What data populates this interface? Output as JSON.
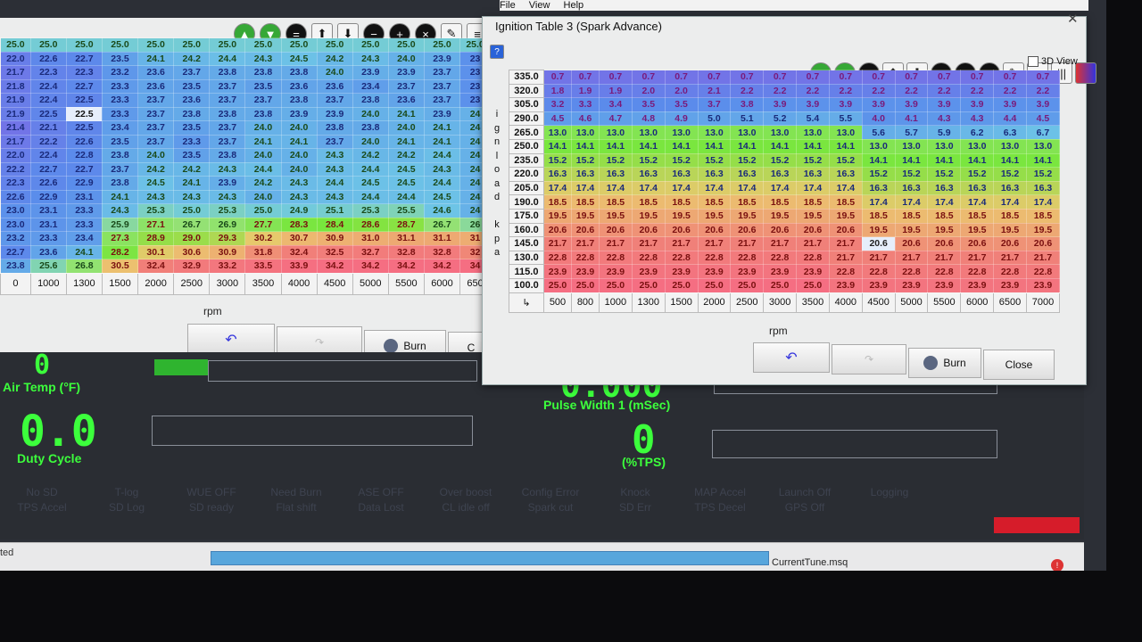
{
  "menubar": [
    "File",
    "View",
    "Help"
  ],
  "right_window": {
    "title": "Ignition Table 3 (Spark Advance)",
    "view3d_label": "3D View",
    "y_axis_label": [
      "i",
      "g",
      "n",
      "l",
      "o",
      "a",
      "d",
      "",
      "k",
      "p",
      "a"
    ],
    "x_axis_label": "rpm",
    "load_bins": [
      "335.0",
      "320.0",
      "305.0",
      "290.0",
      "265.0",
      "250.0",
      "235.0",
      "220.0",
      "205.0",
      "190.0",
      "175.0",
      "160.0",
      "145.0",
      "130.0",
      "115.0",
      "100.0"
    ],
    "rpm_bins": [
      "500",
      "800",
      "1000",
      "1300",
      "1500",
      "2000",
      "2500",
      "3000",
      "3500",
      "4000",
      "4500",
      "5000",
      "5500",
      "6000",
      "6500",
      "7000"
    ],
    "rows": [
      [
        "0.7",
        "0.7",
        "0.7",
        "0.7",
        "0.7",
        "0.7",
        "0.7",
        "0.7",
        "0.7",
        "0.7",
        "0.7",
        "0.7",
        "0.7",
        "0.7",
        "0.7",
        "0.7"
      ],
      [
        "1.8",
        "1.9",
        "1.9",
        "2.0",
        "2.0",
        "2.1",
        "2.2",
        "2.2",
        "2.2",
        "2.2",
        "2.2",
        "2.2",
        "2.2",
        "2.2",
        "2.2",
        "2.2"
      ],
      [
        "3.2",
        "3.3",
        "3.4",
        "3.5",
        "3.5",
        "3.7",
        "3.8",
        "3.9",
        "3.9",
        "3.9",
        "3.9",
        "3.9",
        "3.9",
        "3.9",
        "3.9",
        "3.9"
      ],
      [
        "4.5",
        "4.6",
        "4.7",
        "4.8",
        "4.9",
        "5.0",
        "5.1",
        "5.2",
        "5.4",
        "5.5",
        "4.0",
        "4.1",
        "4.3",
        "4.3",
        "4.4",
        "4.5"
      ],
      [
        "13.0",
        "13.0",
        "13.0",
        "13.0",
        "13.0",
        "13.0",
        "13.0",
        "13.0",
        "13.0",
        "13.0",
        "5.6",
        "5.7",
        "5.9",
        "6.2",
        "6.3",
        "6.7"
      ],
      [
        "14.1",
        "14.1",
        "14.1",
        "14.1",
        "14.1",
        "14.1",
        "14.1",
        "14.1",
        "14.1",
        "14.1",
        "13.0",
        "13.0",
        "13.0",
        "13.0",
        "13.0",
        "13.0"
      ],
      [
        "15.2",
        "15.2",
        "15.2",
        "15.2",
        "15.2",
        "15.2",
        "15.2",
        "15.2",
        "15.2",
        "15.2",
        "14.1",
        "14.1",
        "14.1",
        "14.1",
        "14.1",
        "14.1"
      ],
      [
        "16.3",
        "16.3",
        "16.3",
        "16.3",
        "16.3",
        "16.3",
        "16.3",
        "16.3",
        "16.3",
        "16.3",
        "15.2",
        "15.2",
        "15.2",
        "15.2",
        "15.2",
        "15.2"
      ],
      [
        "17.4",
        "17.4",
        "17.4",
        "17.4",
        "17.4",
        "17.4",
        "17.4",
        "17.4",
        "17.4",
        "17.4",
        "16.3",
        "16.3",
        "16.3",
        "16.3",
        "16.3",
        "16.3"
      ],
      [
        "18.5",
        "18.5",
        "18.5",
        "18.5",
        "18.5",
        "18.5",
        "18.5",
        "18.5",
        "18.5",
        "18.5",
        "17.4",
        "17.4",
        "17.4",
        "17.4",
        "17.4",
        "17.4"
      ],
      [
        "19.5",
        "19.5",
        "19.5",
        "19.5",
        "19.5",
        "19.5",
        "19.5",
        "19.5",
        "19.5",
        "19.5",
        "18.5",
        "18.5",
        "18.5",
        "18.5",
        "18.5",
        "18.5"
      ],
      [
        "20.6",
        "20.6",
        "20.6",
        "20.6",
        "20.6",
        "20.6",
        "20.6",
        "20.6",
        "20.6",
        "20.6",
        "19.5",
        "19.5",
        "19.5",
        "19.5",
        "19.5",
        "19.5"
      ],
      [
        "21.7",
        "21.7",
        "21.7",
        "21.7",
        "21.7",
        "21.7",
        "21.7",
        "21.7",
        "21.7",
        "21.7",
        "20.6",
        "20.6",
        "20.6",
        "20.6",
        "20.6",
        "20.6"
      ],
      [
        "22.8",
        "22.8",
        "22.8",
        "22.8",
        "22.8",
        "22.8",
        "22.8",
        "22.8",
        "22.8",
        "21.7",
        "21.7",
        "21.7",
        "21.7",
        "21.7",
        "21.7",
        "21.7"
      ],
      [
        "23.9",
        "23.9",
        "23.9",
        "23.9",
        "23.9",
        "23.9",
        "23.9",
        "23.9",
        "23.9",
        "22.8",
        "22.8",
        "22.8",
        "22.8",
        "22.8",
        "22.8",
        "22.8"
      ],
      [
        "25.0",
        "25.0",
        "25.0",
        "25.0",
        "25.0",
        "25.0",
        "25.0",
        "25.0",
        "25.0",
        "23.9",
        "23.9",
        "23.9",
        "23.9",
        "23.9",
        "23.9",
        "23.9"
      ]
    ],
    "buttons": {
      "undo": "",
      "redo": "",
      "burn": "Burn",
      "close": "Close"
    }
  },
  "left_window": {
    "x_axis_label": "rpm",
    "rpm_bins": [
      "0",
      "1000",
      "1300",
      "1500",
      "2000",
      "2500",
      "3000",
      "3500",
      "4000",
      "4500",
      "5000",
      "5500",
      "6000",
      "650"
    ],
    "rows": [
      [
        "25.0",
        "25.0",
        "25.0",
        "25.0",
        "25.0",
        "25.0",
        "25.0",
        "25.0",
        "25.0",
        "25.0",
        "25.0",
        "25.0",
        "25.0",
        "25.0"
      ],
      [
        "22.0",
        "22.6",
        "22.7",
        "23.5",
        "24.1",
        "24.2",
        "24.4",
        "24.3",
        "24.5",
        "24.2",
        "24.3",
        "24.0",
        "23.9",
        "23"
      ],
      [
        "21.7",
        "22.3",
        "22.3",
        "23.2",
        "23.6",
        "23.7",
        "23.8",
        "23.8",
        "23.8",
        "24.0",
        "23.9",
        "23.9",
        "23.7",
        "23"
      ],
      [
        "21.8",
        "22.4",
        "22.7",
        "23.3",
        "23.6",
        "23.5",
        "23.7",
        "23.5",
        "23.6",
        "23.6",
        "23.4",
        "23.7",
        "23.7",
        "23"
      ],
      [
        "21.9",
        "22.4",
        "22.5",
        "23.3",
        "23.7",
        "23.6",
        "23.7",
        "23.7",
        "23.8",
        "23.7",
        "23.8",
        "23.6",
        "23.7",
        "23"
      ],
      [
        "21.9",
        "22.5",
        "22.5",
        "23.3",
        "23.7",
        "23.8",
        "23.8",
        "23.8",
        "23.9",
        "23.9",
        "24.0",
        "24.1",
        "23.9",
        "24"
      ],
      [
        "21.4",
        "22.1",
        "22.5",
        "23.4",
        "23.7",
        "23.5",
        "23.7",
        "24.0",
        "24.0",
        "23.8",
        "23.8",
        "24.0",
        "24.1",
        "24"
      ],
      [
        "21.7",
        "22.2",
        "22.6",
        "23.5",
        "23.7",
        "23.3",
        "23.7",
        "24.1",
        "24.1",
        "23.7",
        "24.0",
        "24.1",
        "24.1",
        "24"
      ],
      [
        "22.0",
        "22.4",
        "22.8",
        "23.8",
        "24.0",
        "23.5",
        "23.8",
        "24.0",
        "24.0",
        "24.3",
        "24.2",
        "24.2",
        "24.4",
        "24"
      ],
      [
        "22.2",
        "22.7",
        "22.7",
        "23.7",
        "24.2",
        "24.2",
        "24.3",
        "24.4",
        "24.0",
        "24.3",
        "24.4",
        "24.5",
        "24.3",
        "24"
      ],
      [
        "22.3",
        "22.6",
        "22.9",
        "23.8",
        "24.5",
        "24.1",
        "23.9",
        "24.2",
        "24.3",
        "24.4",
        "24.5",
        "24.5",
        "24.4",
        "24"
      ],
      [
        "22.6",
        "22.9",
        "23.1",
        "24.1",
        "24.3",
        "24.3",
        "24.3",
        "24.0",
        "24.3",
        "24.3",
        "24.4",
        "24.4",
        "24.5",
        "24"
      ],
      [
        "23.0",
        "23.1",
        "23.3",
        "24.3",
        "25.3",
        "25.0",
        "25.3",
        "25.0",
        "24.9",
        "25.1",
        "25.3",
        "25.5",
        "24.6",
        "24"
      ],
      [
        "23.0",
        "23.1",
        "23.3",
        "25.9",
        "27.1",
        "26.7",
        "26.9",
        "27.7",
        "28.3",
        "28.4",
        "28.6",
        "28.7",
        "26.7",
        "26"
      ],
      [
        "23.2",
        "23.3",
        "23.4",
        "27.3",
        "28.9",
        "29.0",
        "29.3",
        "30.2",
        "30.7",
        "30.9",
        "31.0",
        "31.1",
        "31.1",
        "31"
      ],
      [
        "22.7",
        "23.6",
        "24.1",
        "28.2",
        "30.1",
        "30.6",
        "30.9",
        "31.8",
        "32.4",
        "32.5",
        "32.7",
        "32.8",
        "32.8",
        "32"
      ],
      [
        "23.8",
        "25.6",
        "26.8",
        "30.5",
        "32.4",
        "32.9",
        "33.2",
        "33.5",
        "33.9",
        "34.2",
        "34.2",
        "34.2",
        "34.2",
        "34"
      ]
    ],
    "buttons": {
      "undo": "",
      "redo": "",
      "burn": "Burn",
      "close": "C"
    }
  },
  "gauges": {
    "air_temp": {
      "value": "0",
      "label": "Air Temp (°F)"
    },
    "duty_cycle": {
      "value": "0.0",
      "label": "Duty Cycle"
    },
    "pulse_width": {
      "value": "0.000",
      "label": "Pulse Width 1 (mSec)"
    },
    "tps": {
      "value": "0",
      "label": "(%TPS)"
    }
  },
  "status_indicators": [
    [
      "No SD",
      "TPS Accel"
    ],
    [
      "T-log",
      "SD Log"
    ],
    [
      "WUE OFF",
      "SD ready"
    ],
    [
      "Need Burn",
      "Flat shift"
    ],
    [
      "ASE OFF",
      "Data Lost"
    ],
    [
      "Over boost",
      "CL idle off"
    ],
    [
      "Config Error",
      "Spark cut"
    ],
    [
      "Knock",
      "SD Err"
    ],
    [
      "MAP Accel",
      "TPS Decel"
    ],
    [
      "Launch Off",
      "GPS Off"
    ],
    [
      "Logging",
      ""
    ]
  ],
  "statusbar": {
    "left_text": "ted",
    "file": "CurrentTune.msq"
  },
  "colors": {
    "gauge": "#3cff3c",
    "logging": "#d61c2a",
    "progress": "#58a6dc"
  }
}
